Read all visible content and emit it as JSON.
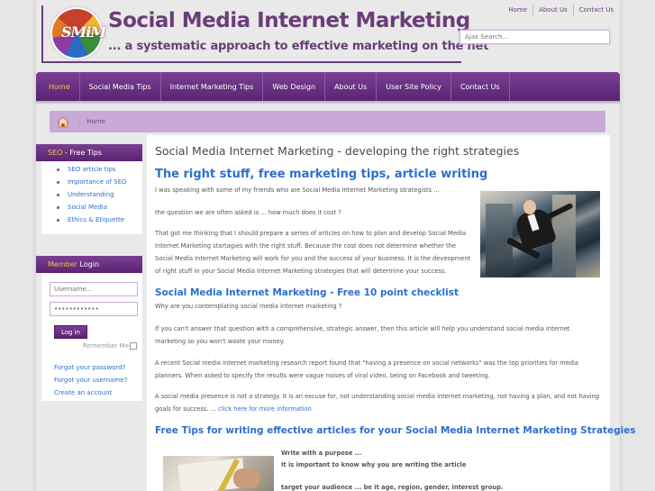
{
  "header": {
    "logo_letters": "SMiM",
    "title": "Social Media Internet Marketing",
    "tagline": "... a systematic approach to effective marketing on the net"
  },
  "toplinks": [
    "Home",
    "About Us",
    "Contact Us"
  ],
  "search": {
    "placeholder": "Ajax Search..."
  },
  "nav": {
    "items": [
      "Home",
      "Social Media Tips",
      "Internet Marketing Tips",
      "Web Design",
      "About Us",
      "User Site Policy",
      "Contact Us"
    ],
    "active_index": 0
  },
  "breadcrumb": {
    "home": "Home"
  },
  "sidebar": {
    "seo": {
      "title_accent": "SEO",
      "title_rest": " - Free Tips",
      "items": [
        "SEO article tips",
        "Importance of SEO",
        "Understanding",
        "Social Media",
        "Ethics & Etiquette"
      ]
    },
    "login": {
      "title_accent": "Member",
      "title_rest": " Login",
      "username_placeholder": "Username...",
      "password_value": "••••••••••••",
      "login_label": "Log in",
      "remember_label": "Remember Me",
      "links": [
        "Forgot your password?",
        "Forgot your username?",
        "Create an account"
      ]
    }
  },
  "content": {
    "page_title": "Social Media Internet Marketing - developing the right strategies",
    "section1": {
      "heading": "The right stuff, free marketing tips, article writing",
      "p1": "I was speaking with some of my friends who are Social Media Internet Marketing strategists ...",
      "p2": "the question we are often asked is ... how much does it cost ?",
      "p3": "That got me thinking that I should prepare a series of articles on how to plan and develop Social Media Internet Marketing startagies with the right stuff. Because the cost does not determine whether the Social Media Internet Marketing will work for you and the success of your business. It is the deveopment of right stuff in your Social Media Internet Marketing strategies that will determine your success."
    },
    "section2": {
      "heading": "Social Media Internet Marketing - Free 10 point checklist",
      "p1": "Why are you contemplating social media internet marketing ?",
      "p2": "If you can't answer that question with a comprehensive, strategic answer, then this article will help you understand social media internet marketing so you won't waste your money.",
      "p3": "A recent Social media internet marketing research report found that \"having a presence on social networks\" was the top priorities for media planners. When asked to specify the results were vague noises of viral video, being on Facebook and tweeting.",
      "p4": "A social media presence is not a strategy. It is an excuse for, not understanding social media internet marketing, not having a plan, and not having goals for success. ...",
      "link": "click here for more information"
    },
    "section3": {
      "heading": "Free Tips for writing effective articles for your Social Media Internet Marketing Strategies",
      "b1": "Write with a purpose ...",
      "b2": "It is important to know why you are writing the article",
      "b3": "target your audience ... be it age, region, gender, interest group."
    }
  }
}
